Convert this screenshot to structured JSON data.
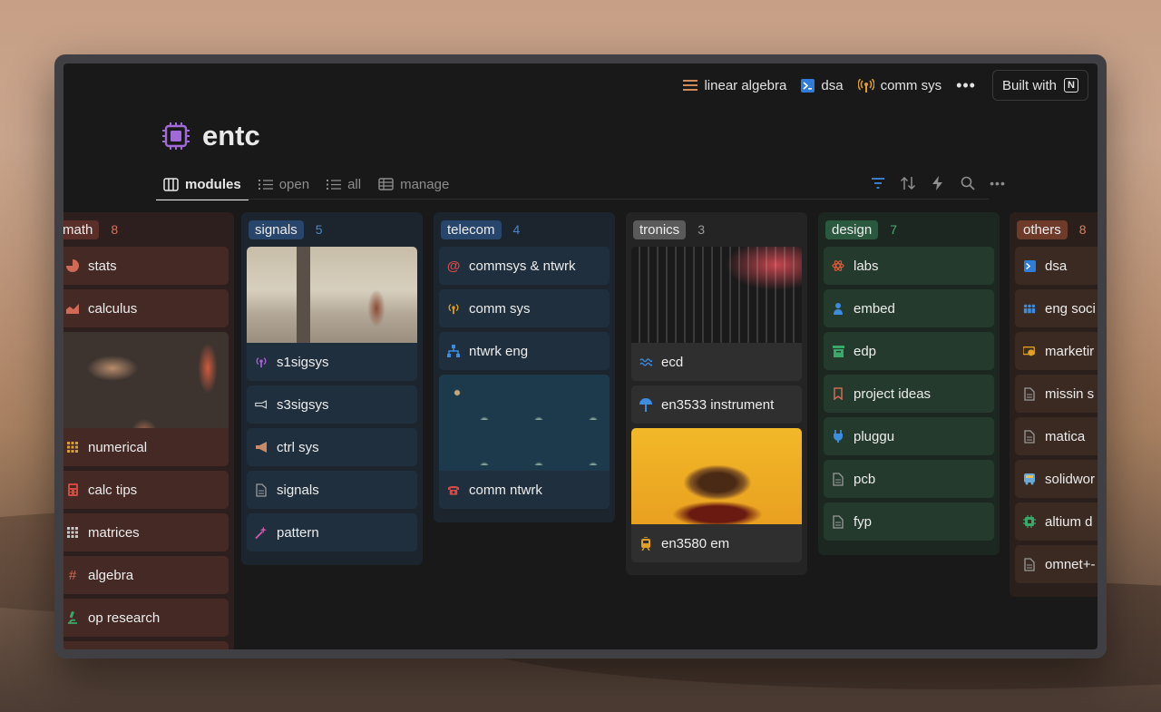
{
  "nav": {
    "links": [
      {
        "label": "linear algebra",
        "icon": "menu-lines-icon"
      },
      {
        "label": "dsa",
        "icon": "terminal-icon"
      },
      {
        "label": "comm sys",
        "icon": "antenna-icon"
      }
    ],
    "built_with": "Built with",
    "notion_letter": "N"
  },
  "page": {
    "title": "entc",
    "icon": "chip-icon"
  },
  "tabs": [
    {
      "label": "modules",
      "icon": "board-icon"
    },
    {
      "label": "open",
      "icon": "list-icon"
    },
    {
      "label": "all",
      "icon": "list-icon"
    },
    {
      "label": "manage",
      "icon": "table-icon"
    }
  ],
  "columns": [
    {
      "name": "math",
      "count": "8",
      "cards": [
        "stats",
        "calculus",
        "numerical",
        "calc tips",
        "matrices",
        "algebra",
        "op research"
      ]
    },
    {
      "name": "signals",
      "count": "5",
      "cards": [
        "s1sigsys",
        "s3sigsys",
        "ctrl sys",
        "signals",
        "pattern"
      ]
    },
    {
      "name": "telecom",
      "count": "4",
      "cards": [
        "commsys & ntwrk",
        "comm sys",
        "ntwrk eng",
        "comm ntwrk"
      ]
    },
    {
      "name": "tronics",
      "count": "3",
      "cards": [
        "ecd",
        "en3533 instrument",
        "en3580 em"
      ]
    },
    {
      "name": "design",
      "count": "7",
      "cards": [
        "labs",
        "embed",
        "edp",
        "project ideas",
        "pluggu",
        "pcb",
        "fyp"
      ]
    },
    {
      "name": "others",
      "count": "8",
      "cards": [
        "dsa",
        "eng soci",
        "marketir",
        "missin s",
        "matica",
        "solidwor",
        "altium d",
        "omnet+-"
      ]
    }
  ],
  "colors": {
    "math": "#5a2f29",
    "signals": "#28456c",
    "telecom": "#28456c",
    "tronics": "#5a5a5a",
    "design": "#2b593f",
    "others": "#6e3b2b"
  }
}
